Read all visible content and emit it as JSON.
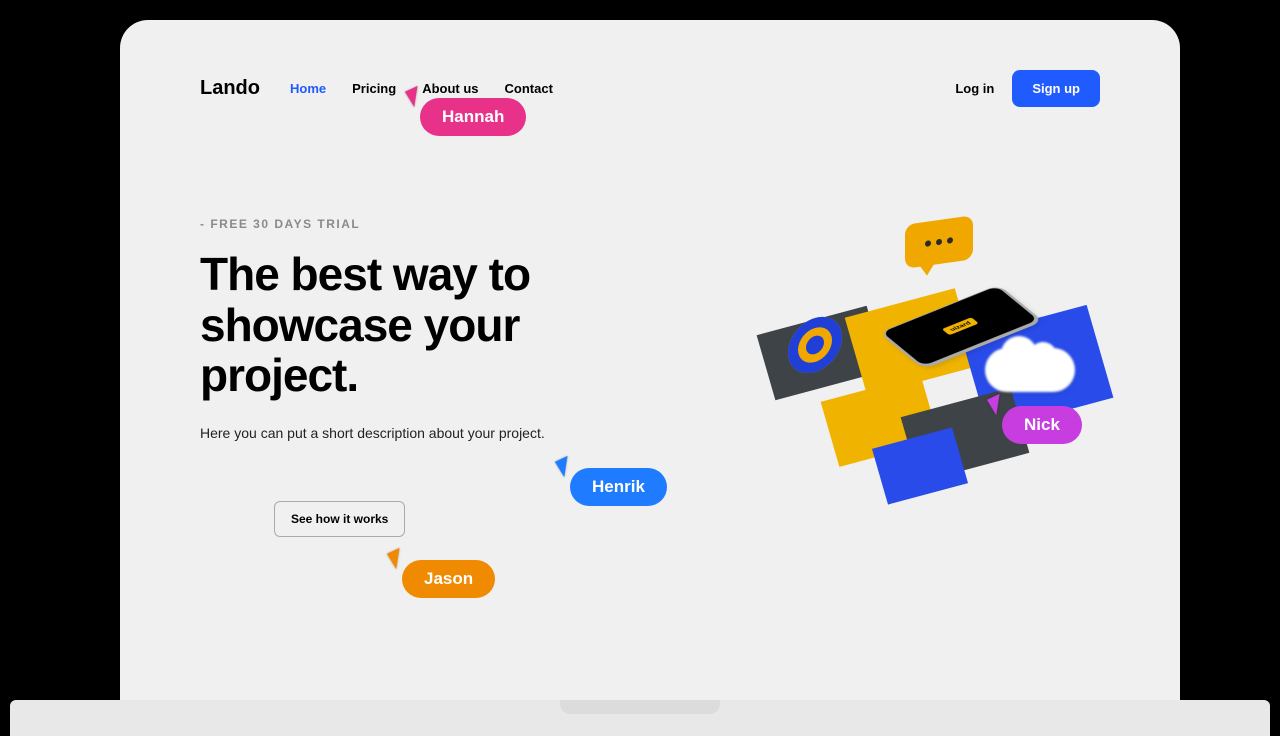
{
  "brand": "Lando",
  "nav": {
    "home": "Home",
    "pricing": "Pricing",
    "about": "About us",
    "contact": "Contact"
  },
  "auth": {
    "login": "Log in",
    "signup": "Sign up"
  },
  "hero": {
    "eyebrow": "- FREE 30 DAYS TRIAL",
    "headline": "The best way to showcase your project.",
    "subtext": "Here you can put a short description about your project.",
    "cta": "See how it works"
  },
  "phone_label": "uizard",
  "collaborators": {
    "hannah": {
      "name": "Hannah",
      "color": "#e83289"
    },
    "henrik": {
      "name": "Henrik",
      "color": "#1f7bff"
    },
    "jason": {
      "name": "Jason",
      "color": "#f08a00"
    },
    "nick": {
      "name": "Nick",
      "color": "#c83de0"
    }
  }
}
